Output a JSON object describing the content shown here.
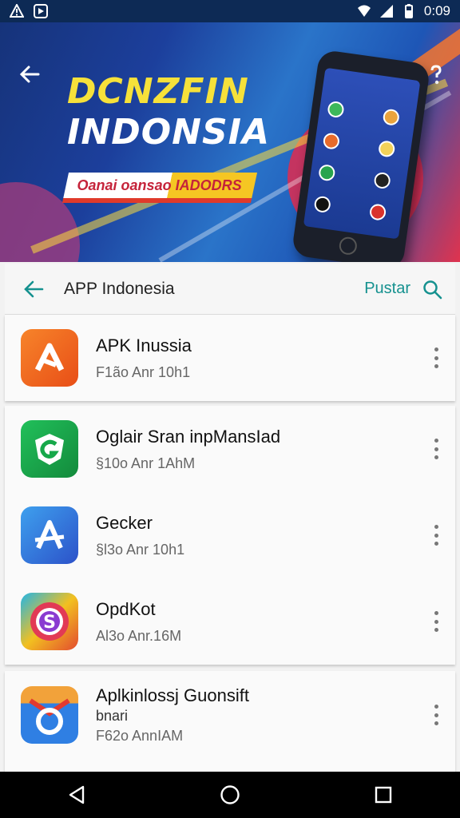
{
  "status_bar": {
    "time": "0:09"
  },
  "banner": {
    "title_line1": "DCNZFIN",
    "title_line2": "INDONSIA",
    "ribbon_text": "Oanai oansao IADODRS"
  },
  "app_bar": {
    "title": "APP Indonesia",
    "link_label": "Pustar"
  },
  "apps": [
    {
      "name": "APK Inussia",
      "meta": "F1ão Anr 10h1",
      "icon": "apk-logo-icon",
      "color": "#f0601c"
    },
    {
      "name": "Oglair Sran inpMansIad",
      "meta": "§10o Anr 1AhM",
      "icon": "g-shield-icon",
      "color": "#16a84a"
    },
    {
      "name": "Gecker",
      "meta": "§l3o Anr 10h1",
      "icon": "a-logo-icon",
      "color": "#2d6fe0"
    },
    {
      "name": "OpdKot",
      "meta": "Al3o Anr.16M",
      "icon": "s-circle-icon",
      "color": "#e23a55"
    },
    {
      "name": "Aplkinlossj Guonsift",
      "sub": "bnari",
      "meta": "F62o AnnIAM",
      "icon": "mail-ring-icon",
      "color": "#2f7fe3"
    }
  ]
}
